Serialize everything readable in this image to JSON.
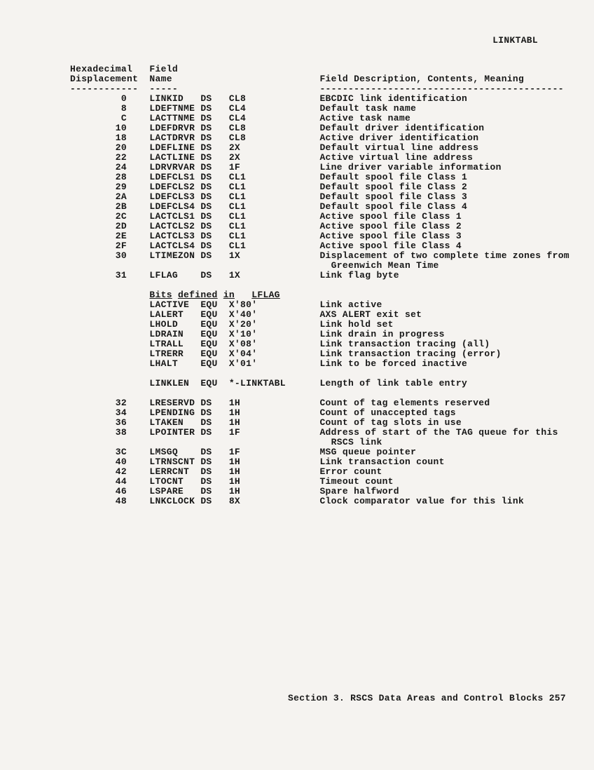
{
  "topRightLabel": "LINKTABL",
  "headers": {
    "col1a": "Hexadecimal",
    "col1b": "Displacement",
    "col2a": "Field",
    "col2b": "Name",
    "col3": "Field Description, Contents, Meaning"
  },
  "rows": [
    {
      "disp": "0",
      "name": "LINKID",
      "op": "DS",
      "def": "CL8",
      "desc": "EBCDIC link identification"
    },
    {
      "disp": "8",
      "name": "LDEFTNME",
      "op": "DS",
      "def": "CL4",
      "desc": "Default task name"
    },
    {
      "disp": "C",
      "name": "LACTTNME",
      "op": "DS",
      "def": "CL4",
      "desc": "Active task name"
    },
    {
      "disp": "10",
      "name": "LDEFDRVR",
      "op": "DS",
      "def": "CL8",
      "desc": "Default driver identification"
    },
    {
      "disp": "18",
      "name": "LACTDRVR",
      "op": "DS",
      "def": "CL8",
      "desc": "Active driver identification"
    },
    {
      "disp": "20",
      "name": "LDEFLINE",
      "op": "DS",
      "def": "2X",
      "desc": "Default virtual line address"
    },
    {
      "disp": "22",
      "name": "LACTLINE",
      "op": "DS",
      "def": "2X",
      "desc": "Active virtual line address"
    },
    {
      "disp": "24",
      "name": "LDRVRVAR",
      "op": "DS",
      "def": "1F",
      "desc": "Line driver variable information"
    },
    {
      "disp": "28",
      "name": "LDEFCLS1",
      "op": "DS",
      "def": "CL1",
      "desc": "Default spool file Class 1"
    },
    {
      "disp": "29",
      "name": "LDEFCLS2",
      "op": "DS",
      "def": "CL1",
      "desc": "Default spool file Class 2"
    },
    {
      "disp": "2A",
      "name": "LDEFCLS3",
      "op": "DS",
      "def": "CL1",
      "desc": "Default spool file Class 3"
    },
    {
      "disp": "2B",
      "name": "LDEFCLS4",
      "op": "DS",
      "def": "CL1",
      "desc": "Default spool file Class 4"
    },
    {
      "disp": "2C",
      "name": "LACTCLS1",
      "op": "DS",
      "def": "CL1",
      "desc": "Active spool file Class 1"
    },
    {
      "disp": "2D",
      "name": "LACTCLS2",
      "op": "DS",
      "def": "CL1",
      "desc": "Active spool file Class 2"
    },
    {
      "disp": "2E",
      "name": "LACTCLS3",
      "op": "DS",
      "def": "CL1",
      "desc": "Active spool file Class 3"
    },
    {
      "disp": "2F",
      "name": "LACTCLS4",
      "op": "DS",
      "def": "CL1",
      "desc": "Active spool file Class 4"
    },
    {
      "disp": "30",
      "name": "LTIMEZON",
      "op": "DS",
      "def": "1X",
      "desc": "Displacement of two complete time zones from"
    },
    {
      "disp": "",
      "name": "",
      "op": "",
      "def": "",
      "desc": "  Greenwich Mean Time"
    },
    {
      "disp": "31",
      "name": "LFLAG",
      "op": "DS",
      "def": "1X",
      "desc": "Link flag byte"
    }
  ],
  "bitsHeader": {
    "text1": "Bits",
    "text2": "defined",
    "text3": "in",
    "text4": "LFLAG"
  },
  "bitRows": [
    {
      "name": "LACTIVE",
      "op": "EQU",
      "def": "X'80'",
      "desc": "Link active"
    },
    {
      "name": "LALERT",
      "op": "EQU",
      "def": "X'40'",
      "desc": "AXS ALERT exit set"
    },
    {
      "name": "LHOLD",
      "op": "EQU",
      "def": "X'20'",
      "desc": "Link hold set"
    },
    {
      "name": "LDRAIN",
      "op": "EQU",
      "def": "X'10'",
      "desc": "Link drain in progress"
    },
    {
      "name": "LTRALL",
      "op": "EQU",
      "def": "X'08'",
      "desc": "Link transaction tracing (all)"
    },
    {
      "name": "LTRERR",
      "op": "EQU",
      "def": "X'04'",
      "desc": "Link transaction tracing (error)"
    },
    {
      "name": "LHALT",
      "op": "EQU",
      "def": "X'01'",
      "desc": "Link to be forced inactive"
    }
  ],
  "linklen": {
    "name": "LINKLEN",
    "op": "EQU",
    "def": "*-LINKTABL",
    "desc": "Length of link table entry"
  },
  "rows2": [
    {
      "disp": "32",
      "name": "LRESERVD",
      "op": "DS",
      "def": "1H",
      "desc": "Count of tag elements reserved"
    },
    {
      "disp": "34",
      "name": "LPENDING",
      "op": "DS",
      "def": "1H",
      "desc": "Count of unaccepted tags"
    },
    {
      "disp": "36",
      "name": "LTAKEN",
      "op": "DS",
      "def": "1H",
      "desc": "Count of tag slots in use"
    },
    {
      "disp": "38",
      "name": "LPOINTER",
      "op": "DS",
      "def": "1F",
      "desc": "Address of start of the TAG queue for this"
    },
    {
      "disp": "",
      "name": "",
      "op": "",
      "def": "",
      "desc": "  RSCS link"
    },
    {
      "disp": "3C",
      "name": "LMSGQ",
      "op": "DS",
      "def": "1F",
      "desc": "MSG queue pointer"
    },
    {
      "disp": "40",
      "name": "LTRNSCNT",
      "op": "DS",
      "def": "1H",
      "desc": "Link transaction count"
    },
    {
      "disp": "42",
      "name": "LERRCNT",
      "op": "DS",
      "def": "1H",
      "desc": "Error count"
    },
    {
      "disp": "44",
      "name": "LTOCNT",
      "op": "DS",
      "def": "1H",
      "desc": "Timeout count"
    },
    {
      "disp": "46",
      "name": "LSPARE",
      "op": "DS",
      "def": "1H",
      "desc": "Spare halfword"
    },
    {
      "disp": "48",
      "name": "LNKCLOCK",
      "op": "DS",
      "def": "8X",
      "desc": "Clock comparator value for this link"
    }
  ],
  "footer": "Section 3. RSCS Data Areas and Control Blocks  257"
}
